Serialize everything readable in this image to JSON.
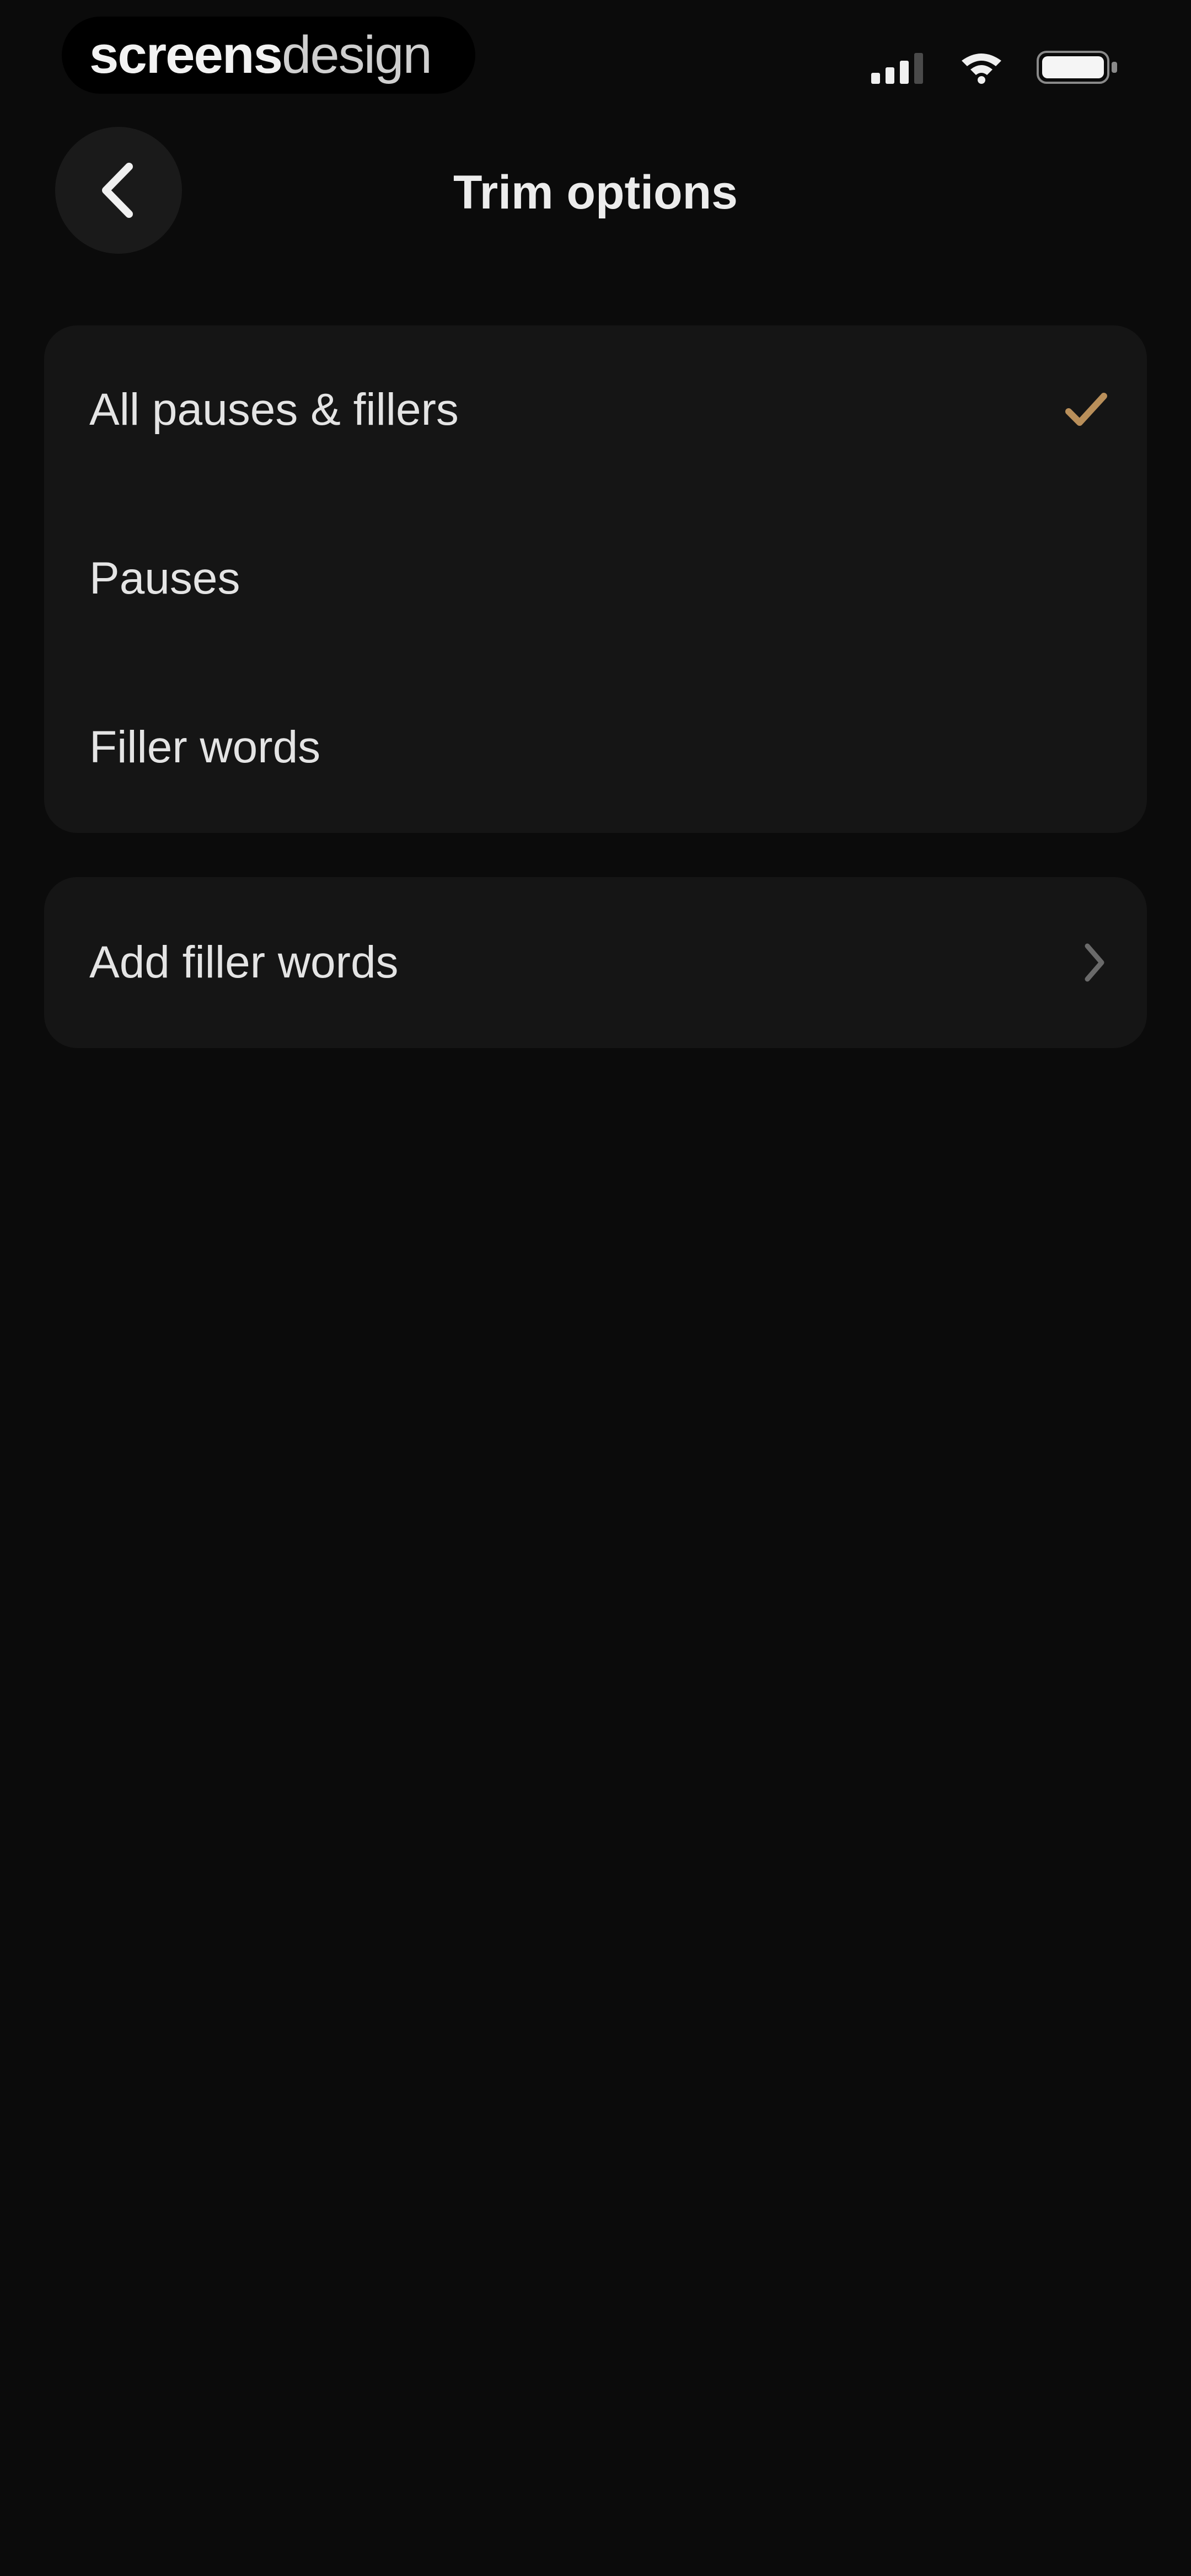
{
  "status_bar": {
    "brand_strong": "screens",
    "brand_light": "design"
  },
  "header": {
    "title": "Trim options"
  },
  "options": [
    {
      "label": "All pauses & fillers",
      "selected": true
    },
    {
      "label": "Pauses",
      "selected": false
    },
    {
      "label": "Filler words",
      "selected": false
    }
  ],
  "add_filler": {
    "label": "Add filler words"
  },
  "colors": {
    "accent": "#b98f5a",
    "background": "#0b0b0b",
    "card": "#151515"
  },
  "icons": {
    "back": "chevron-left-icon",
    "selected": "checkmark-icon",
    "navigate": "chevron-right-icon"
  }
}
